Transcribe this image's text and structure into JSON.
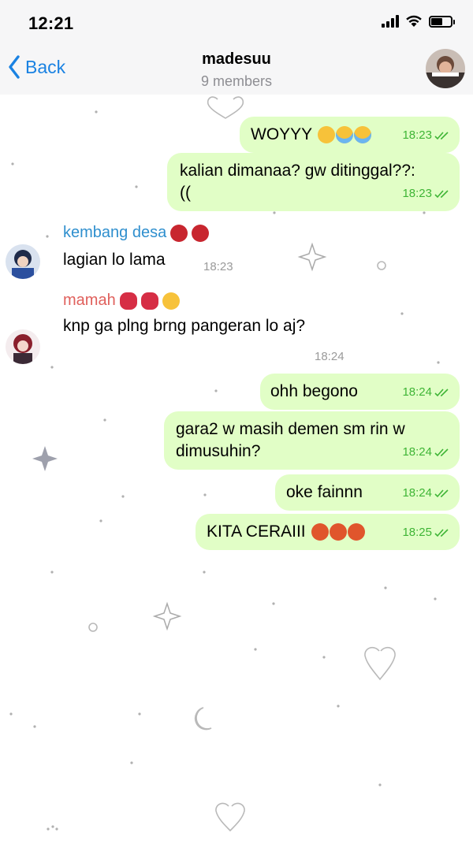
{
  "status_bar": {
    "time": "12:21"
  },
  "header": {
    "back_label": "Back",
    "title": "madesuu",
    "subtitle": "9 members"
  },
  "messages": [
    {
      "dir": "out",
      "text": "WOYYY",
      "emojis": [
        "pleading-face",
        "sob-face",
        "sob-face"
      ],
      "time": "18:23",
      "status": "read"
    },
    {
      "dir": "out",
      "lines": [
        "kalian dimanaa? gw ditinggal??:",
        "(("
      ],
      "time": "18:23",
      "status": "read"
    },
    {
      "dir": "in",
      "sender": "kembang desa",
      "sender_emojis": [
        "ogre-mask",
        "ogre-mask"
      ],
      "text": "lagian lo lama",
      "time": "18:23"
    },
    {
      "dir": "in",
      "sender": "mamah",
      "sender_emojis": [
        "kiss-mark",
        "kiss-mark",
        "heart-eyes"
      ],
      "text": "knp ga plng brng pangeran lo aj?",
      "time": "18:24"
    },
    {
      "dir": "out",
      "text": "ohh begono",
      "time": "18:24",
      "status": "read"
    },
    {
      "dir": "out",
      "lines": [
        "gara2 w masih demen sm rin w",
        "dimusuhin?"
      ],
      "time": "18:24",
      "status": "read"
    },
    {
      "dir": "out",
      "text": "oke fainnn",
      "time": "18:24",
      "status": "read"
    },
    {
      "dir": "out",
      "text": "KITA CERAIII",
      "emojis": [
        "cursing-face",
        "cursing-face",
        "cursing-face"
      ],
      "time": "18:25",
      "status": "read"
    }
  ],
  "colors": {
    "outgoing_bubble": "#e1fec6",
    "time_outgoing": "#3fb536",
    "sender_kembang": "#2f8fce",
    "sender_mamah": "#e0605c",
    "accent": "#1a82e2"
  }
}
